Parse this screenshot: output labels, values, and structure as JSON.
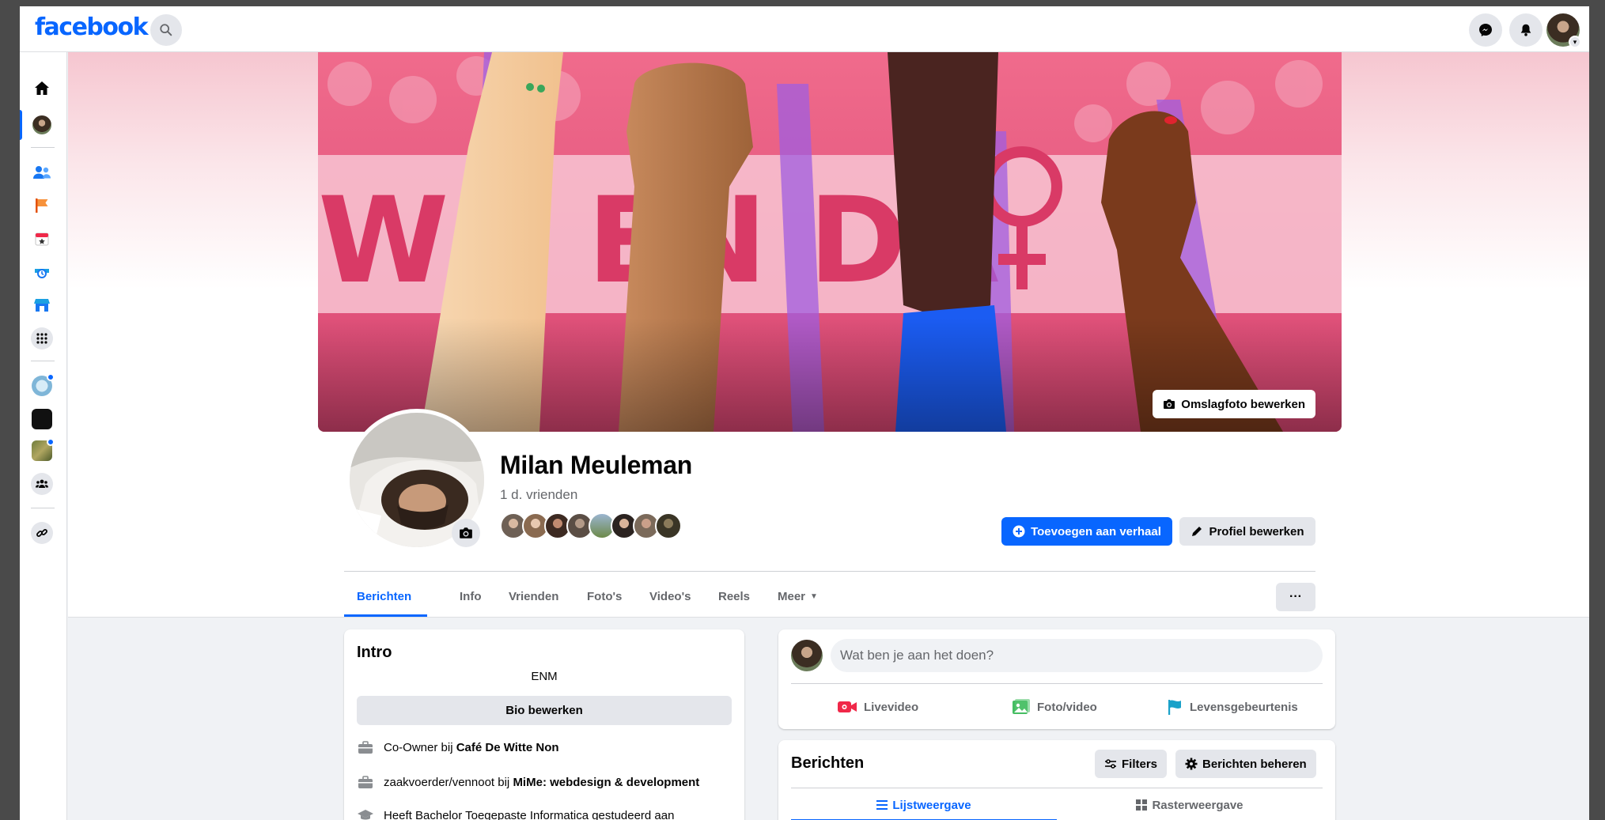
{
  "brand": {
    "logo": "facebook",
    "accent": "#0866ff"
  },
  "topbar": {
    "icons": [
      "search-icon",
      "messenger-icon",
      "bell-icon",
      "account-avatar"
    ]
  },
  "rail": {
    "icons": [
      "home-icon",
      "profile-avatar",
      "friends-icon",
      "pages-flag-icon",
      "events-icon",
      "memories-icon",
      "marketplace-icon",
      "apps-grid-icon",
      "group-shortcut-1",
      "group-shortcut-2",
      "group-shortcut-3",
      "groups-icon",
      "link-icon"
    ]
  },
  "cover": {
    "edit_label": "Omslagfoto bewerken"
  },
  "profile": {
    "name": "Milan Meuleman",
    "friends_count": "1 d. vrienden",
    "add_story_label": "Toevoegen aan verhaal",
    "edit_profile_label": "Profiel bewerken"
  },
  "tabs": [
    {
      "label": "Berichten",
      "active": true
    },
    {
      "label": "Info"
    },
    {
      "label": "Vrienden"
    },
    {
      "label": "Foto's"
    },
    {
      "label": "Video's"
    },
    {
      "label": "Reels"
    },
    {
      "label": "Meer"
    }
  ],
  "more_label": "···",
  "intro": {
    "title": "Intro",
    "bio": "ENM",
    "bio_edit_label": "Bio bewerken",
    "rows": [
      {
        "prefix": "Co-Owner bij ",
        "bold": "Café De Witte Non"
      },
      {
        "prefix": "zaakvoerder/vennoot bij ",
        "bold": "MiMe: webdesign & development"
      },
      {
        "prefix": "Heeft Bachelor Toegepaste Informatica gestudeerd aan",
        "bold": ""
      }
    ]
  },
  "composer": {
    "placeholder": "Wat ben je aan het doen?",
    "actions": [
      {
        "label": "Livevideo",
        "color": "#f02849"
      },
      {
        "label": "Foto/video",
        "color": "#45bd62"
      },
      {
        "label": "Levensgebeurtenis",
        "color": "#1aa1c9"
      }
    ]
  },
  "posts": {
    "title": "Berichten",
    "filters_label": "Filters",
    "manage_label": "Berichten beheren",
    "views": [
      {
        "label": "Lijstweergave",
        "active": true
      },
      {
        "label": "Rasterweergave"
      }
    ]
  }
}
